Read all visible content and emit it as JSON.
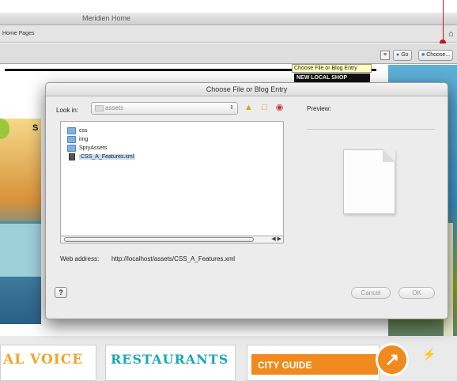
{
  "window": {
    "title": "Meridien Home"
  },
  "toolbar": {
    "breadcrumb": "Home Pages",
    "buttons": {
      "go": "Go",
      "choose": "Choose..."
    },
    "tooltip": "Choose File or Blog Entry"
  },
  "page": {
    "promo": "NEW LOCAL SHOP",
    "nav_letter": "S",
    "cards": {
      "local_voice": "AL VOICE",
      "restaurants": "RESTAURANTS",
      "city_guide": "CITY GUIDE"
    }
  },
  "dialog": {
    "title": "Choose File or Blog Entry",
    "look_in_label": "Look in:",
    "look_in_value": "assets",
    "preview_label": "Preview:",
    "files": [
      {
        "name": "css",
        "type": "folder"
      },
      {
        "name": "img",
        "type": "folder"
      },
      {
        "name": "SpryAssets",
        "type": "folder"
      },
      {
        "name": "CSS_A_Features.xml",
        "type": "file",
        "selected": true
      }
    ],
    "web_address_label": "Web address:",
    "web_address_value": "http://localhost/assets/CSS_A_Features.xml",
    "help_label": "?",
    "cancel_label": "Cancel",
    "ok_label": "OK"
  },
  "icons": {
    "home": "home-icon",
    "folder": "folder-icon",
    "document": "document-icon",
    "new_folder": "new-folder-icon",
    "up_folder": "up-folder-icon",
    "site_root": "site-root-icon"
  },
  "colors": {
    "accent_red": "#c0141e",
    "tooltip_bg": "#ffffc6",
    "selection": "#c8dcf4",
    "city_guide_orange": "#f08a1e",
    "restaurants_teal": "#19a7b8",
    "local_voice_orange": "#f2a52a"
  }
}
